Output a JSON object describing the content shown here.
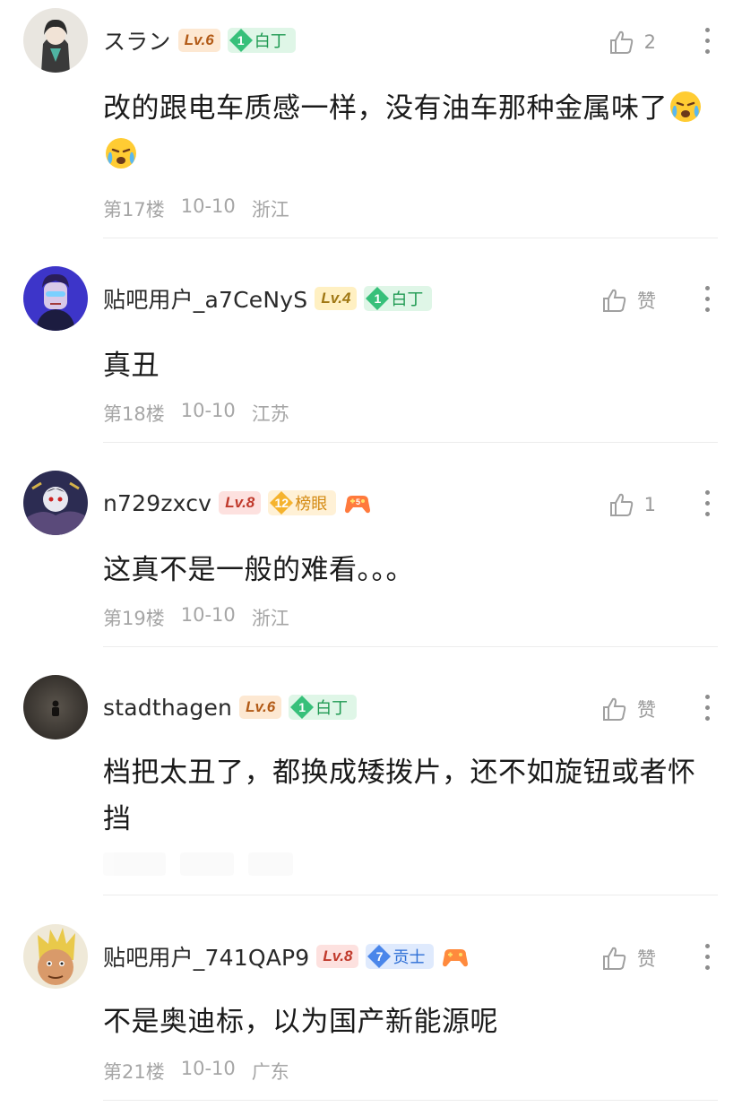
{
  "comments": [
    {
      "username": "スラン",
      "level": "Lv.6",
      "badge_num": "1",
      "badge_text": "白丁",
      "like_count": "2",
      "text": "改的跟电车质感一样，没有油车那种金属味了",
      "floor": "第17楼",
      "date": "10-10",
      "region": "浙江"
    },
    {
      "username": "贴吧用户_a7CeNyS",
      "level": "Lv.4",
      "badge_num": "1",
      "badge_text": "白丁",
      "like_count": "赞",
      "text": "真丑",
      "floor": "第18楼",
      "date": "10-10",
      "region": "江苏"
    },
    {
      "username": "n729zxcv",
      "level": "Lv.8",
      "badge_num": "12",
      "badge_text": "榜眼",
      "like_count": "1",
      "text": "这真不是一般的难看。。。",
      "floor": "第19楼",
      "date": "10-10",
      "region": "浙江"
    },
    {
      "username": "stadthagen",
      "level": "Lv.6",
      "badge_num": "1",
      "badge_text": "白丁",
      "like_count": "赞",
      "text": "档把太丑了，都换成矮拨片，还不如旋钮或者怀挡"
    },
    {
      "username": "贴吧用户_741QAP9",
      "level": "Lv.8",
      "badge_num": "7",
      "badge_text": "贡士",
      "like_count": "赞",
      "text": "不是奥迪标，以为国产新能源呢",
      "floor": "第21楼",
      "date": "10-10",
      "region": "广东"
    }
  ],
  "colors": {
    "badge_green": "#1f9a52",
    "badge_blue": "#2d6fd6",
    "badge_gold": "#d48a12",
    "meta_gray": "#a6a6a6"
  },
  "icons": {
    "like": "thumbs-up-icon",
    "more": "vertical-ellipsis-icon",
    "emoji": "crying-face-emoji",
    "game": "game-controller-icon"
  }
}
